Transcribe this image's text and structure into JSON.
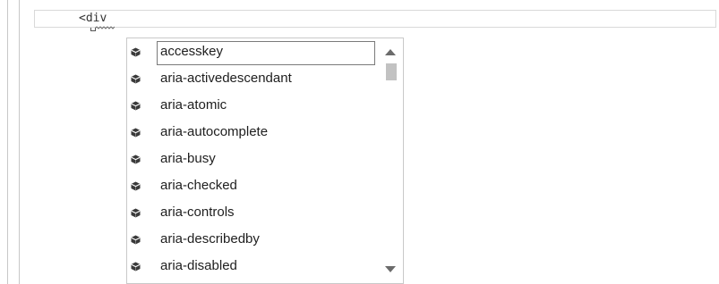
{
  "editor": {
    "code_text": "<div"
  },
  "completion": {
    "items": [
      {
        "label": "accesskey",
        "selected": true
      },
      {
        "label": "aria-activedescendant"
      },
      {
        "label": "aria-atomic"
      },
      {
        "label": "aria-autocomplete"
      },
      {
        "label": "aria-busy"
      },
      {
        "label": "aria-checked"
      },
      {
        "label": "aria-controls"
      },
      {
        "label": "aria-describedby"
      },
      {
        "label": "aria-disabled"
      }
    ],
    "item_icon": "attribute-cube-icon",
    "scroll_position_fraction": 0.0
  },
  "colors": {
    "text": "#1e1e1e",
    "icon": "#3a3a3a",
    "selection_border": "#7a7a7a",
    "squiggle": "#6e6e6e"
  }
}
